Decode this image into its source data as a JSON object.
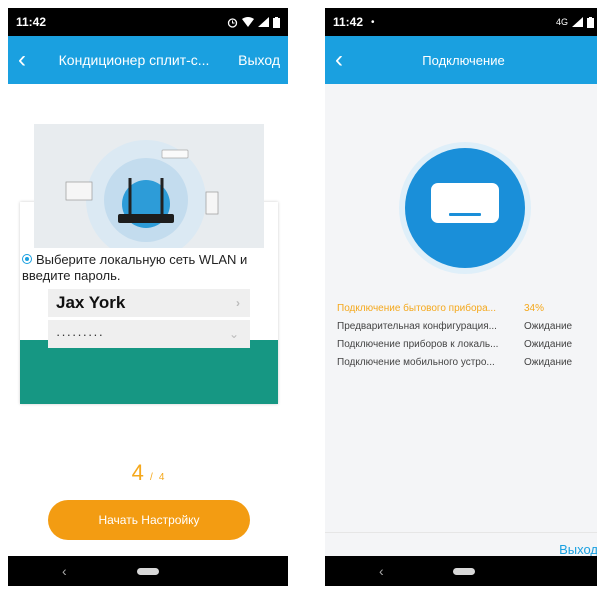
{
  "phone1": {
    "status": {
      "time": "11:42",
      "icons": [
        "alarm-icon",
        "wifi-icon",
        "signal-icon",
        "battery-icon"
      ]
    },
    "header": {
      "title": "Кондиционер сплит-с...",
      "exit": "Выход"
    },
    "instruction": "Выберите локальную сеть WLAN и введите пароль.",
    "ssid_value": "Jax York",
    "password_value": "·········",
    "step": {
      "current": "4",
      "total": "4"
    },
    "start_button": "Начать Настройку"
  },
  "phone2": {
    "status": {
      "time": "11:42",
      "network": "4G",
      "icons": [
        "notification-dot-icon",
        "signal-icon",
        "battery-icon"
      ]
    },
    "header": {
      "title": "Подключение"
    },
    "rows": [
      {
        "label": "Подключение бытового прибора...",
        "value": "34%"
      },
      {
        "label": "Предварительная конфигурация...",
        "value": "Ожидание"
      },
      {
        "label": "Подключение приборов к локаль...",
        "value": "Ожидание"
      },
      {
        "label": "Подключение мобильного устро...",
        "value": "Ожидание"
      }
    ],
    "exit": "Выход"
  },
  "colors": {
    "primary": "#1aa0e0",
    "accent": "#f39c12",
    "teal": "#169783"
  }
}
